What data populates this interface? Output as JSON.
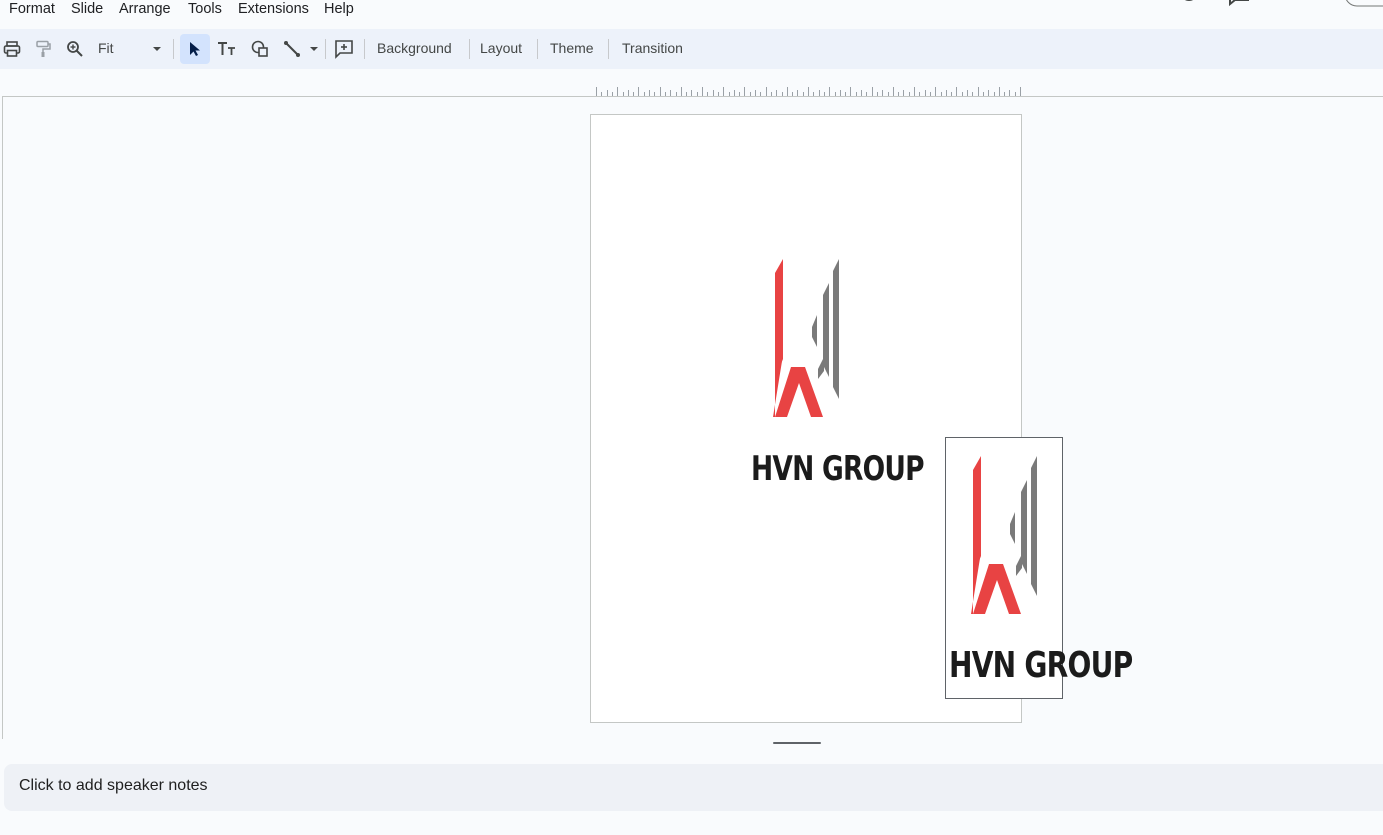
{
  "menu": {
    "items": [
      "Format",
      "Slide",
      "Arrange",
      "Tools",
      "Extensions",
      "Help"
    ]
  },
  "toolbar": {
    "zoom_value": "Fit",
    "background_label": "Background",
    "layout_label": "Layout",
    "theme_label": "Theme",
    "transition_label": "Transition",
    "icons": [
      "print-icon",
      "paint-format-icon",
      "zoom-icon",
      "select-cursor-icon",
      "text-box-icon",
      "shape-icon",
      "line-icon",
      "new-comment-icon"
    ]
  },
  "slide": {
    "main_logo_text": "HVN GROUP",
    "inserted_image_text": "HVN GROUP",
    "colors": {
      "logo_red": "#e84343",
      "logo_gray": "#7a7a7a",
      "logo_text": "#1b1b1b"
    }
  },
  "notes": {
    "placeholder": "Click to add speaker notes"
  },
  "colors": {
    "toolbar_bg": "#edf2fa",
    "selected_tool_bg": "#d3e3fd",
    "canvas_bg": "#f9fbfd"
  }
}
